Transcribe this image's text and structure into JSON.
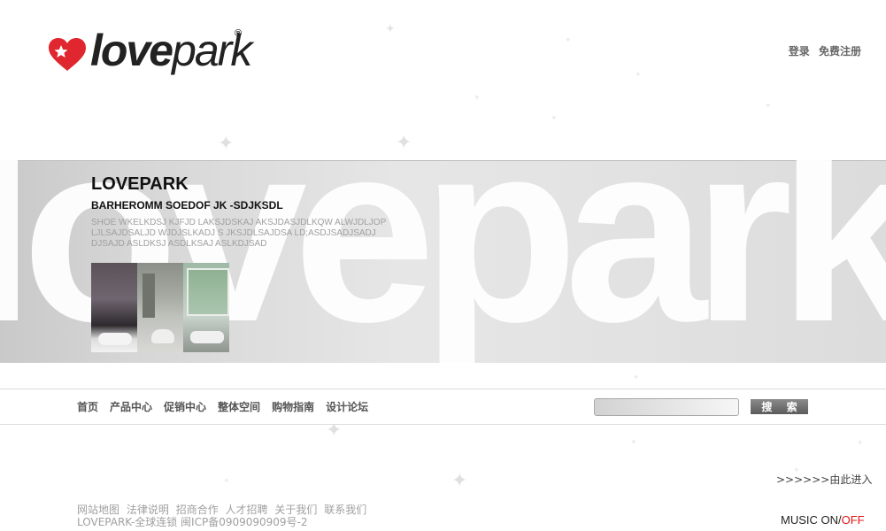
{
  "header": {
    "brand_bold": "love",
    "brand_regular": "park",
    "registered_mark": "®",
    "login_label": "登录",
    "register_label": "免费注册"
  },
  "banner": {
    "background_word": "lovepark",
    "title": "LOVEPARK",
    "subtitle": "BARHEROMM SOEDOF JK -SDJKSDL",
    "description": "SHOE WKELKDSJ KJFJD LAKSJDSKAJ AKSJDASJDLKQW ALWJDLJOP LJLSAJDSALJD WJDJSLKADJ S JKSJDLSAJDSA LD;ASDJSADJSADJ DJSAJD ASLDKSJ ASDLKSAJ  ASLKDJSAD"
  },
  "nav": {
    "items": [
      "首页",
      "产品中心",
      "促销中心",
      "整体空间",
      "购物指南",
      "设计论坛"
    ]
  },
  "search": {
    "placeholder": "",
    "button_label": "搜 索"
  },
  "enter_link": ">>>>>>由此进入",
  "footer": {
    "links": [
      "网站地图",
      "法律说明",
      "招商合作",
      "人才招聘",
      "关于我们",
      "联系我们"
    ],
    "copyright": "LOVEPARK-全球连锁 闽ICP备0909090909号-2"
  },
  "music": {
    "prefix": "MUSIC ",
    "on": "ON",
    "separator": "/",
    "off": "OFF"
  },
  "colors": {
    "brand_red": "#e0262e",
    "accent_red": "#e01818",
    "text_gray": "#a0a0a0"
  }
}
